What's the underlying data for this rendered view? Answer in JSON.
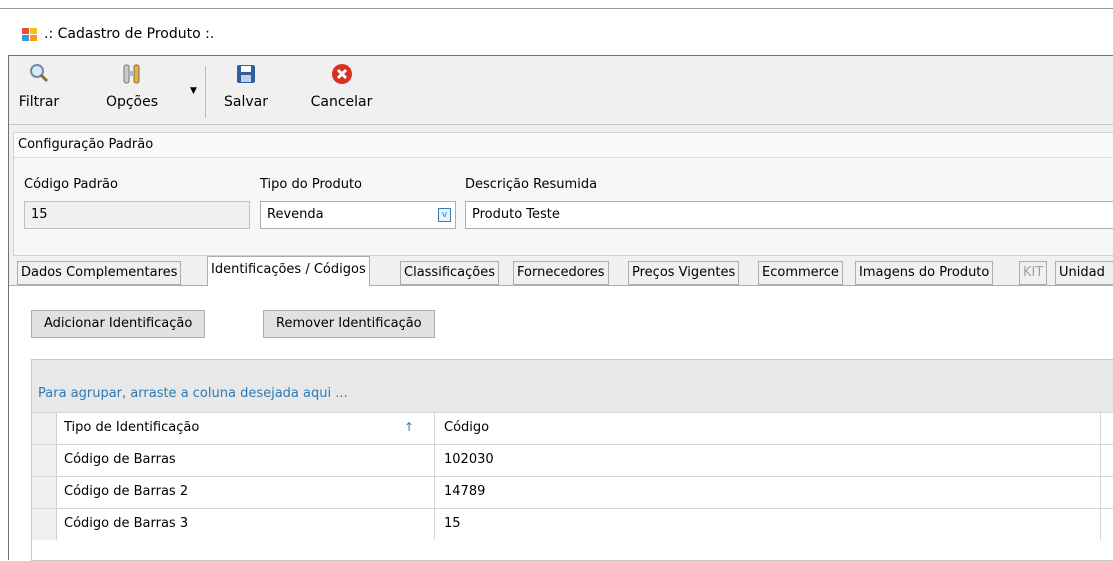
{
  "window": {
    "title": ".: Cadastro de Produto :."
  },
  "toolbar": {
    "filtrar": "Filtrar",
    "opcoes": "Opções",
    "salvar": "Salvar",
    "cancelar": "Cancelar"
  },
  "config": {
    "section_title": "Configuração Padrão",
    "codigo_label": "Código Padrão",
    "codigo_value": "15",
    "tipo_label": "Tipo do Produto",
    "tipo_value": "Revenda",
    "descricao_label": "Descrição Resumida",
    "descricao_value": "Produto Teste"
  },
  "tabs": [
    {
      "label": "Dados Complementares"
    },
    {
      "label": "Identificações / Códigos"
    },
    {
      "label": "Classificações"
    },
    {
      "label": "Fornecedores"
    },
    {
      "label": "Preços Vigentes"
    },
    {
      "label": "Ecommerce"
    },
    {
      "label": "Imagens do Produto"
    },
    {
      "label": "KIT"
    },
    {
      "label": "Unidad"
    }
  ],
  "panel": {
    "add_button": "Adicionar Identificação",
    "remove_button": "Remover Identificação",
    "group_hint": "Para agrupar, arraste a coluna desejada aqui ...",
    "columns": [
      "Tipo de Identificação",
      "Código"
    ],
    "sort_glyph": "↑",
    "rows": [
      {
        "tipo": "Código de Barras",
        "codigo": "102030"
      },
      {
        "tipo": "Código de Barras 2",
        "codigo": "14789"
      },
      {
        "tipo": "Código de Barras 3",
        "codigo": "15"
      }
    ]
  },
  "colors": {
    "accent": "#2a7ab8",
    "window_bg": "#f0f0f0"
  }
}
